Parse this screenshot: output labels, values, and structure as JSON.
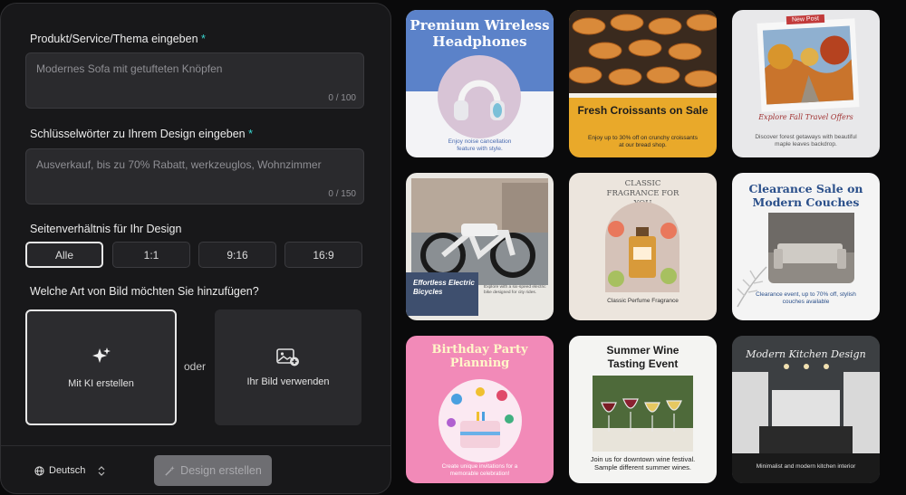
{
  "form": {
    "product_label": "Produkt/Service/Thema eingeben",
    "required_mark": "*",
    "product_placeholder": "Modernes Sofa mit getufteten Knöpfen",
    "product_count": "0 / 100",
    "keywords_label": "Schlüsselwörter zu Ihrem Design eingeben",
    "keywords_placeholder": "Ausverkauf, bis zu 70% Rabatt, werkzeuglos, Wohnzimmer",
    "keywords_count": "0 / 150",
    "ratio_label": "Seitenverhältnis für Ihr Design",
    "ratios": [
      "Alle",
      "1:1",
      "9:16",
      "16:9"
    ],
    "selected_ratio": "Alle",
    "image_label": "Welche Art von Bild möchten Sie hinzufügen?",
    "ai_option": "Mit KI erstellen",
    "or_text": "oder",
    "own_image_option": "Ihr Bild verwenden",
    "language": "Deutsch",
    "create_button": "Design erstellen"
  },
  "templates": [
    {
      "title": "Premium Wireless Headphones",
      "caption": "Enjoy noise cancellation feature with style."
    },
    {
      "title": "Fresh Croissants on Sale",
      "caption": "Enjoy up to 30% off on crunchy croissants at our bread shop."
    },
    {
      "badge": "New Post",
      "title": "Explore Fall Travel Offers",
      "caption": "Discover forest getaways with beautiful maple leaves backdrop."
    },
    {
      "title": "Effortless Electric Bicycles",
      "caption": "Explore with a six-speed electric bike designed for city rides."
    },
    {
      "title": "CLASSIC FRAGRANCE FOR YOU",
      "caption": "Classic Perfume Fragrance"
    },
    {
      "title": "Clearance Sale on Modern Couches",
      "caption": "Clearance event, up to 70% off, stylish couches available"
    },
    {
      "title": "Birthday Party Planning",
      "caption": "Create unique invitations for a memorable celebration!"
    },
    {
      "title": "Summer Wine Tasting Event",
      "caption": "Join us for downtown wine festival. Sample different summer wines."
    },
    {
      "title": "Modern Kitchen Design",
      "caption": "Minimalist and modern kitchen interior"
    }
  ],
  "colors": {
    "accent": "#3ad6d0",
    "panel": "#18181a",
    "field": "#2a2a2d",
    "button_disabled": "#6e6e72"
  },
  "icons": [
    "sparkles-icon",
    "image-add-icon",
    "globe-icon",
    "chevron-updown-icon",
    "wand-icon"
  ]
}
